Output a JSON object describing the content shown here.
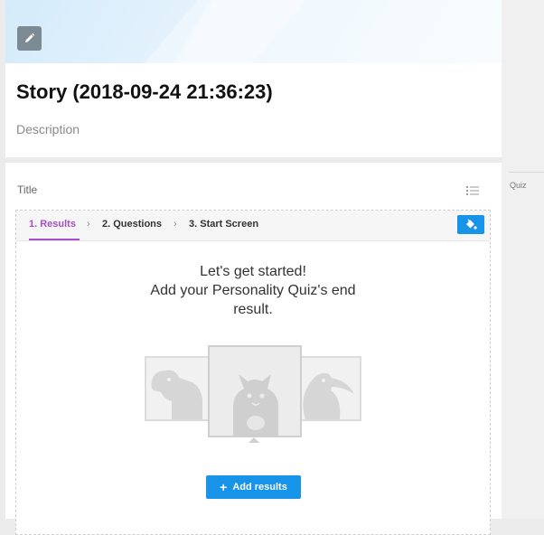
{
  "story": {
    "title": "Story (2018-09-24 21:36:23)",
    "description_placeholder": "Description"
  },
  "header": {
    "edit_icon": "pencil-icon"
  },
  "content": {
    "title_label": "Title",
    "list_icon": "list-icon"
  },
  "tabs": [
    {
      "label": "1. Results",
      "active": true
    },
    {
      "label": "2. Questions",
      "active": false
    },
    {
      "label": "3. Start Screen",
      "active": false
    }
  ],
  "toolbar": {
    "paint_icon": "paint-bucket-icon"
  },
  "intro": {
    "line1": "Let's get started!",
    "line2": "Add your Personality Quiz's end",
    "line3": "result."
  },
  "illustration": {
    "animals": [
      "dog",
      "cat",
      "toucan"
    ]
  },
  "add_results": {
    "plus": "+",
    "label": "Add results"
  },
  "sidebar": {
    "quiz_label": "Quiz"
  },
  "colors": {
    "accent_purple": "#a54fc7",
    "button_blue": "#1793e8",
    "edit_button_gray": "#7c8a94",
    "illustration_gray": "#d8d8d8"
  }
}
